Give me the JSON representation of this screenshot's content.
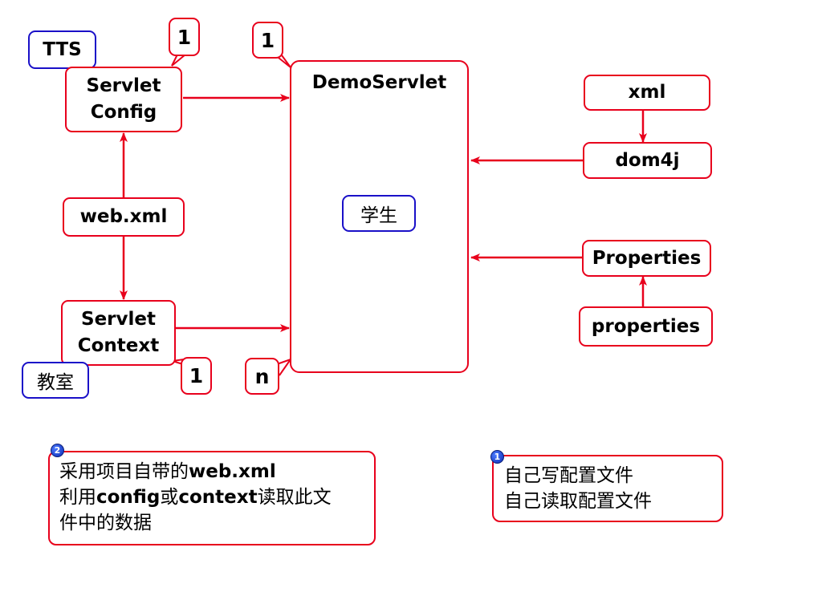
{
  "nodes": {
    "servlet_config": "Servlet\nConfig",
    "servlet_context": "Servlet\nContext",
    "web_xml": "web.xml",
    "demo_servlet": "DemoServlet",
    "xml": "xml",
    "dom4j": "dom4j",
    "properties_class": "Properties",
    "properties_file": "properties"
  },
  "tags": {
    "tts": "TTS",
    "classroom": "教室",
    "student": "学生"
  },
  "callouts": {
    "config_count": "1",
    "servlet_top_count": "1",
    "context_count": "1",
    "servlet_bottom_count": "n"
  },
  "notes": {
    "left": {
      "badge": "2",
      "line1_a": "采用项目自带的",
      "line1_b": "web.xml",
      "line2_a": "利用",
      "line2_b": "config",
      "line2_c": "或",
      "line2_d": "context",
      "line2_e": "读取此文",
      "line3": "件中的数据"
    },
    "right": {
      "badge": "1",
      "line1": "自己写配置文件",
      "line2": "自己读取配置文件"
    }
  },
  "colors": {
    "arrow": "#e8001c",
    "box_border": "#e8001c",
    "tag_border": "#1a10c8",
    "badge": "#1f4fe0"
  }
}
